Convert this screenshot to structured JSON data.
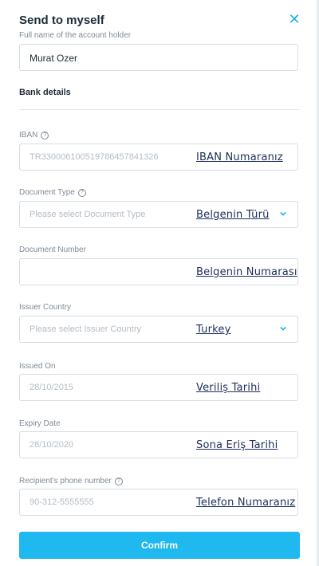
{
  "header": {
    "title": "Send to myself",
    "close_icon": "close-icon",
    "accent_color": "#19b4e8"
  },
  "account_holder": {
    "label": "Full name of the account holder",
    "value": "Murat Ozer"
  },
  "bank_details": {
    "title": "Bank details"
  },
  "iban": {
    "label": "IBAN",
    "help_icon": "help-icon",
    "placeholder": "TR330006100519786457841326",
    "overlay": "IBAN Numaranız"
  },
  "document_type": {
    "label": "Document Type",
    "help_icon": "help-icon",
    "placeholder": "Please select Document Type",
    "overlay": "Belgenin Türü",
    "chevron_icon": "chevron-down-icon"
  },
  "document_number": {
    "label": "Document Number",
    "value": "",
    "overlay": "Belgenin Numarası"
  },
  "issuer_country": {
    "label": "Issuer Country",
    "placeholder": "Please select Issuer Country",
    "overlay": "Turkey",
    "chevron_icon": "chevron-down-icon"
  },
  "issued_on": {
    "label": "Issued On",
    "placeholder": "28/10/2015",
    "overlay": "Veriliş Tarihi"
  },
  "expiry_date": {
    "label": "Expiry Date",
    "placeholder": "28/10/2020",
    "overlay": "Sona Eriş Tarihi"
  },
  "phone": {
    "label": "Recipient's phone number",
    "help_icon": "help-icon",
    "placeholder": "90-312-5555555",
    "overlay": "Telefon Numaranız"
  },
  "confirm": {
    "label": "Confirm",
    "color": "#1fb8ef"
  }
}
